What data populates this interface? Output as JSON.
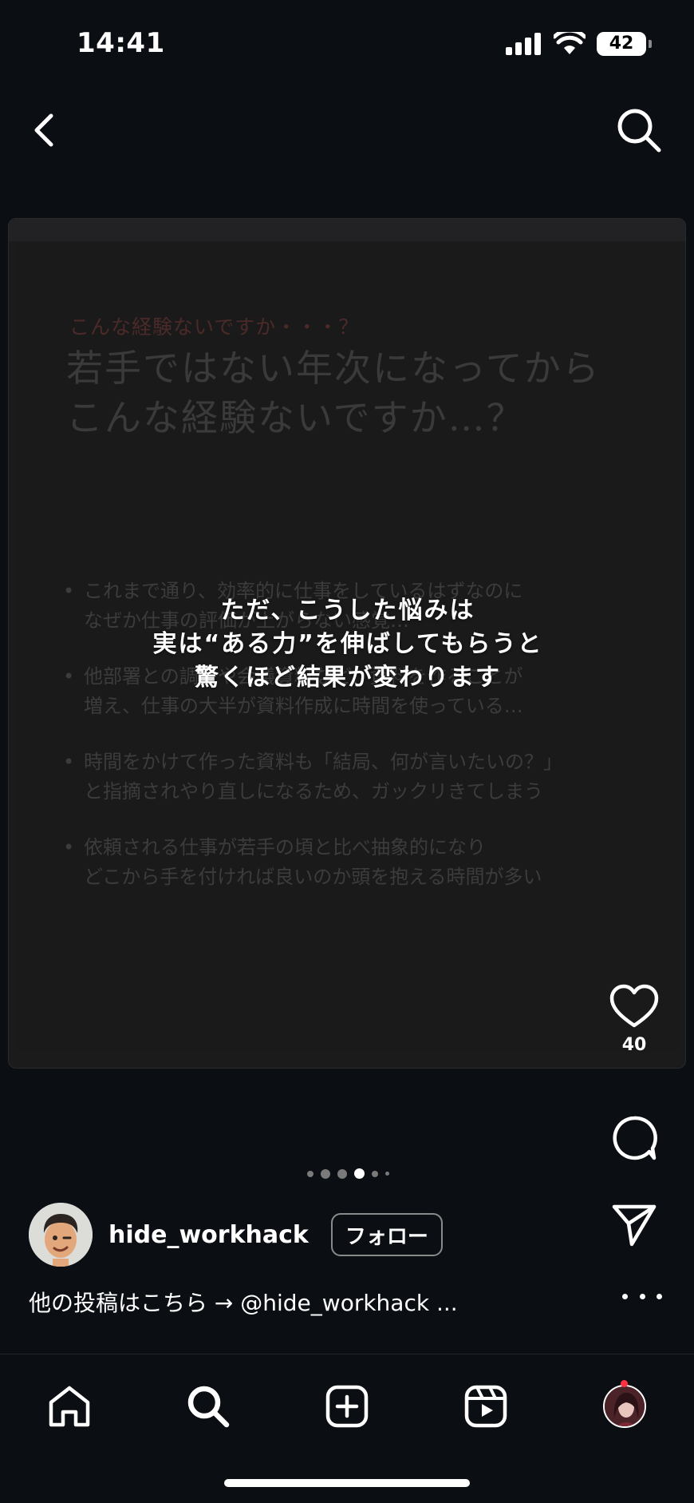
{
  "status_bar": {
    "time": "14:41",
    "battery": "42",
    "icons": [
      "signal-icon",
      "wifi-icon",
      "battery-icon"
    ]
  },
  "top_nav": {
    "icons": [
      "back-chevron-icon",
      "search-icon"
    ]
  },
  "slide": {
    "kicker": "こんな経験ないですか・・・？",
    "title_lines": [
      "若手ではない年次になってから",
      "こんな経験ないですか…？"
    ],
    "bullets": [
      [
        "これまで通り、効率的に仕事をしているはずなのに",
        "なぜか仕事の評価が上がらない感覚…"
      ],
      [
        "他部署との調整や会議資料など、資料を作ることが",
        "増え、仕事の大半が資料作成に時間を使っている…"
      ],
      [
        "時間をかけて作った資料も「結局、何が言いたいの？」",
        "と指摘されやり直しになるため、ガックリきてしまう"
      ],
      [
        "依頼される仕事が若手の頃と比べ抽象的になり",
        "どこから手を付ければ良いのか頭を抱える時間が多い"
      ]
    ],
    "overlay_caption": [
      "ただ、こうした悩みは",
      "実は“ある力”を伸ばしてもらうと",
      "驚くほど結果が変わります"
    ]
  },
  "actions": {
    "like_count": "40",
    "icons": [
      "heart-icon",
      "comment-icon",
      "share-icon"
    ]
  },
  "carousel": {
    "dot_count": 6,
    "active_index": 3
  },
  "author": {
    "username": "hide_workhack",
    "follow_label": "フォロー"
  },
  "caption": {
    "text": "他の投稿はこちら → @hide_workhack ..."
  },
  "tab_bar": {
    "items": [
      "home-icon",
      "search-icon",
      "create-post-icon",
      "reels-icon",
      "profile-avatar"
    ]
  },
  "colors": {
    "background": "#0b0e13",
    "slide_background": "#1a1a1a",
    "kicker": "#4b2a28",
    "notification": "#ff3040"
  }
}
